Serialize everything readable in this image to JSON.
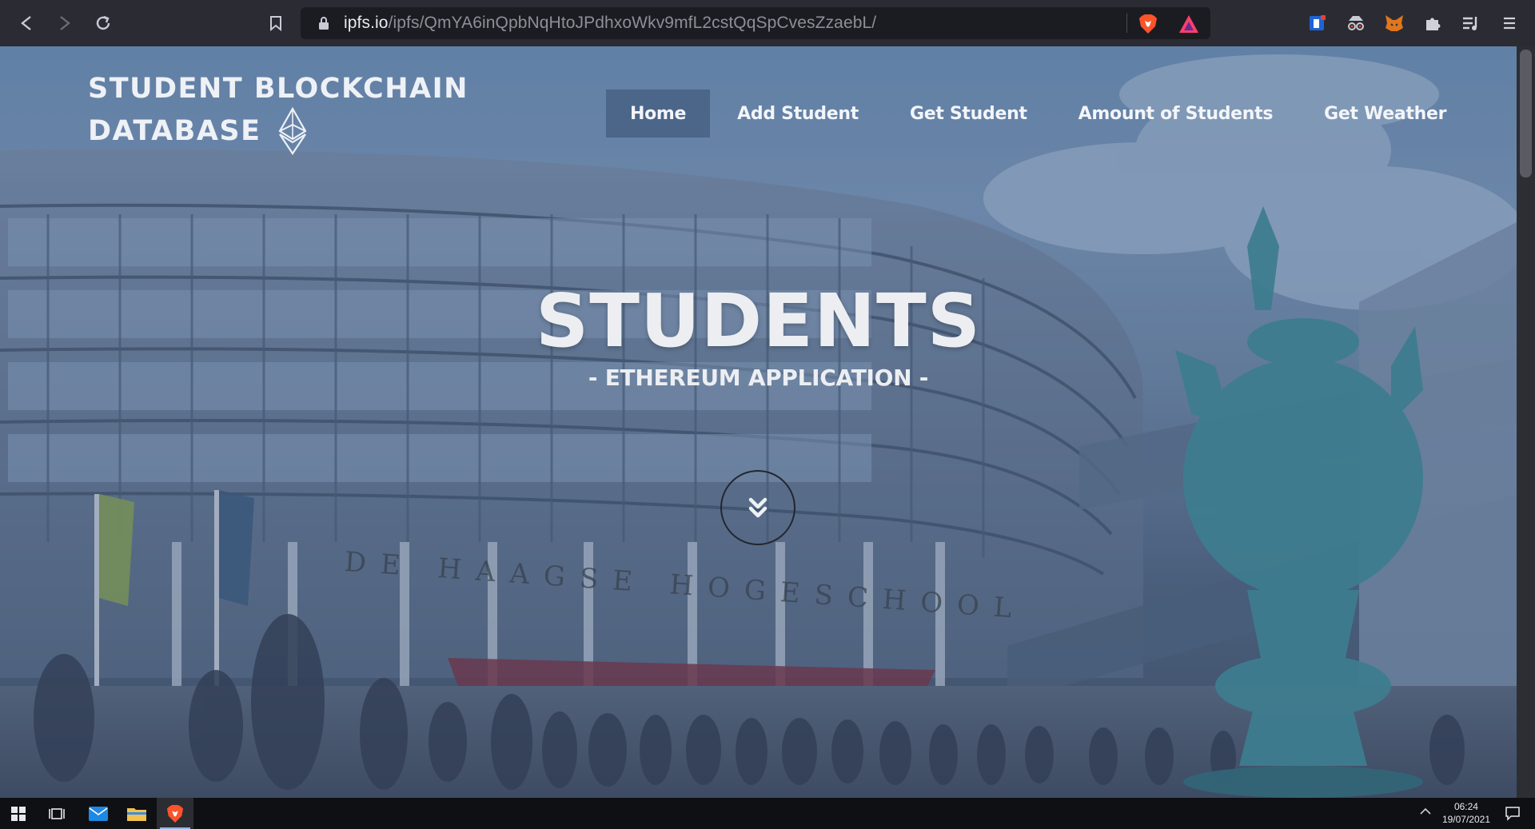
{
  "browser": {
    "url_host": "ipfs.io",
    "url_path": "/ipfs/QmYA6inQpbNqHtoJPdhxoWkv9mfL2cstQqSpCvesZzaebL/"
  },
  "site": {
    "brand_line1": "STUDENT BLOCKCHAIN",
    "brand_line2": "DATABASE",
    "nav": [
      {
        "label": "Home",
        "active": true
      },
      {
        "label": "Add Student",
        "active": false
      },
      {
        "label": "Get Student",
        "active": false
      },
      {
        "label": "Amount of Students",
        "active": false
      },
      {
        "label": "Get Weather",
        "active": false
      }
    ],
    "hero_title": "STUDENTS",
    "hero_subtitle": "- ETHEREUM APPLICATION -",
    "building_sign": "DE HAAGSE HOGESCHOOL"
  },
  "taskbar": {
    "time": "06:24",
    "date": "19/07/2021"
  },
  "colors": {
    "chrome_bg": "#2b2c33",
    "addr_bg": "#1b1c21",
    "nav_active_bg": "#466282",
    "brave_orange": "#fb542b",
    "taskbar_bg": "#0f1013"
  }
}
